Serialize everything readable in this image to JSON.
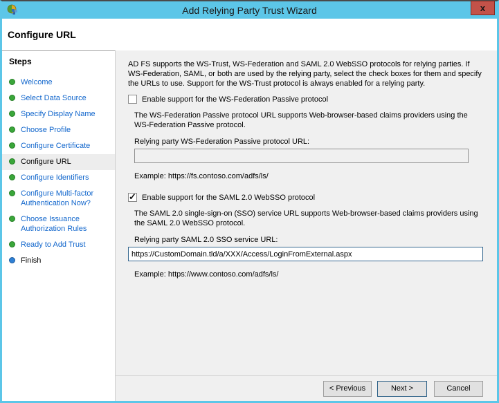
{
  "window": {
    "title": "Add Relying Party Trust Wizard",
    "close_glyph": "x"
  },
  "header": {
    "title": "Configure URL"
  },
  "sidebar": {
    "title": "Steps",
    "items": [
      {
        "label": "Welcome",
        "state": "done"
      },
      {
        "label": "Select Data Source",
        "state": "done"
      },
      {
        "label": "Specify Display Name",
        "state": "done"
      },
      {
        "label": "Choose Profile",
        "state": "done"
      },
      {
        "label": "Configure Certificate",
        "state": "done"
      },
      {
        "label": "Configure URL",
        "state": "current"
      },
      {
        "label": "Configure Identifiers",
        "state": "done"
      },
      {
        "label": "Configure Multi-factor Authentication Now?",
        "state": "done"
      },
      {
        "label": "Choose Issuance Authorization Rules",
        "state": "done"
      },
      {
        "label": "Ready to Add Trust",
        "state": "done"
      },
      {
        "label": "Finish",
        "state": "finish"
      }
    ]
  },
  "main": {
    "intro": "AD FS supports the WS-Trust, WS-Federation and SAML 2.0 WebSSO protocols for relying parties.  If WS-Federation, SAML, or both are used by the relying party, select the check boxes for them and specify the URLs to use.  Support for the WS-Trust protocol is always enabled for a relying party.",
    "wsfed": {
      "checkbox_label": "Enable support for the WS-Federation Passive protocol",
      "checked": false,
      "description": "The WS-Federation Passive protocol URL supports Web-browser-based claims providers using the WS-Federation Passive protocol.",
      "url_label": "Relying party WS-Federation Passive protocol URL:",
      "url_value": "",
      "example": "Example: https://fs.contoso.com/adfs/ls/"
    },
    "saml": {
      "checkbox_label": "Enable support for the SAML 2.0 WebSSO protocol",
      "checked": true,
      "description": "The SAML 2.0 single-sign-on (SSO) service URL supports Web-browser-based claims providers using the SAML 2.0 WebSSO protocol.",
      "url_label": "Relying party SAML 2.0 SSO service URL:",
      "url_value": "https://CustomDomain.tld/a/XXX/Access/LoginFromExternal.aspx",
      "example": "Example: https://www.contoso.com/adfs/ls/"
    }
  },
  "footer": {
    "previous_label": "< Previous",
    "next_label": "Next >",
    "cancel_label": "Cancel"
  },
  "colors": {
    "titlebar_blue": "#5cc6e8",
    "close_red": "#c35249",
    "link_blue": "#1166cc",
    "step_done_green": "#3aa63a",
    "step_finish_blue": "#2f80d4",
    "content_gray": "#f0f0f0",
    "focused_input_border": "#35678f"
  }
}
